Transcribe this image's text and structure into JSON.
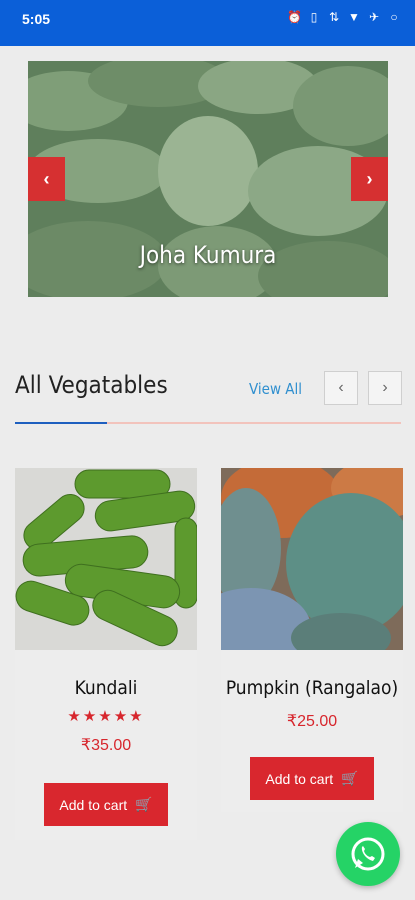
{
  "status_bar": {
    "time": "5:05"
  },
  "hero": {
    "caption": "Joha Kumura",
    "prev_arrow": "‹",
    "next_arrow": "›"
  },
  "section": {
    "title": "All Vegatables",
    "view_all": "View All",
    "prev": "‹",
    "next": "›"
  },
  "products": [
    {
      "name": "Kundali",
      "rating": 5,
      "stars": "★★★★★",
      "price": "₹35.00",
      "cart_label": "Add to cart"
    },
    {
      "name": "Pumpkin (Rangalao)",
      "price": "₹25.00",
      "cart_label": "Add to cart"
    }
  ],
  "colors": {
    "primary_blue": "#0b5fd8",
    "accent_red": "#d9272e",
    "link_blue": "#2f8fcf",
    "whatsapp_green": "#25d366"
  }
}
